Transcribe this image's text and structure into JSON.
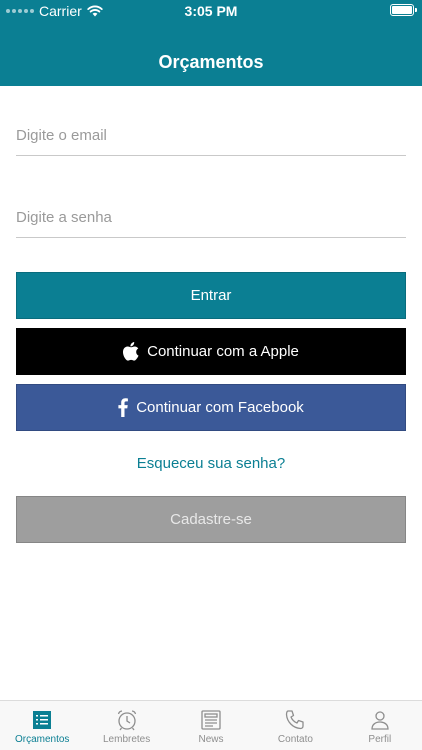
{
  "status_bar": {
    "carrier": "Carrier",
    "time": "3:05 PM"
  },
  "header": {
    "title": "Orçamentos"
  },
  "login": {
    "email_placeholder": "Digite o email",
    "email_value": "",
    "password_placeholder": "Digite a senha",
    "password_value": "",
    "login_label": "Entrar",
    "apple_label": "Continuar com a Apple",
    "facebook_label": "Continuar com Facebook",
    "forgot_label": "Esqueceu sua senha?",
    "signup_label": "Cadastre-se"
  },
  "tabbar": {
    "active_index": 0,
    "items": [
      {
        "label": "Orçamentos",
        "icon": "list-icon"
      },
      {
        "label": "Lembretes",
        "icon": "alarm-clock-icon"
      },
      {
        "label": "News",
        "icon": "newspaper-icon"
      },
      {
        "label": "Contato",
        "icon": "phone-icon"
      },
      {
        "label": "Perfil",
        "icon": "person-icon"
      }
    ]
  },
  "colors": {
    "primary": "#0b7f93",
    "apple": "#000000",
    "facebook": "#3b5998",
    "signup": "#9e9e9e",
    "tab_inactive": "#8e8e8e"
  }
}
